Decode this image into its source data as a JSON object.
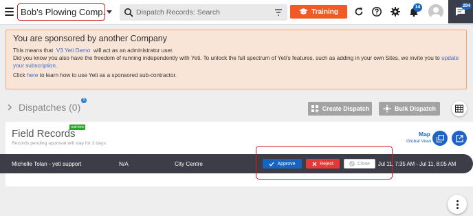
{
  "header": {
    "company_name": "Bob's Plowing Comp...",
    "search_placeholder": "Dispatch Records: Search",
    "training_label": "Training",
    "notification_count": "14",
    "chat_count": "294"
  },
  "sponsor": {
    "title": "You are sponsored by another Company",
    "line1_prefix": "This means that",
    "admin_link": "V3 Yeti Demo",
    "line1_suffix": "will act as an administrator user.",
    "line2": "Did you know you also have the freedom of running independently with Yeti. To unlock the full spectrum of Yeti's features, such as adding in your own Sites, we invite you to",
    "update_link": "update your subscription",
    "line2_end": ".",
    "line3_prefix": "Click",
    "here_link": "here",
    "line3_suffix": "to learn how to use Yeti as a sponsored sub-contractor."
  },
  "dispatches": {
    "title": "Dispatches (0)",
    "help": "?",
    "create_label": "Create Dispatch",
    "bulk_label": "Bulk Dispatch"
  },
  "field_records": {
    "title": "Field Records",
    "badge": "real-time",
    "subtitle": "Records pending approval will stay for 3 days.",
    "map_label": "Map",
    "global_view_label": "Global View",
    "row": {
      "user": "Michelle Tolan - yeti support",
      "value": "N/A",
      "site": "City Centre",
      "approve": "Approve",
      "reject": "Reject",
      "close": "Close",
      "time": "Jul 11, 7:35 AM - Jul 11, 8:05 AM"
    }
  },
  "colors": {
    "accent": "#f15a24",
    "primary": "#1f63c9",
    "reject": "#e53935",
    "highlight": "#d21f26"
  }
}
